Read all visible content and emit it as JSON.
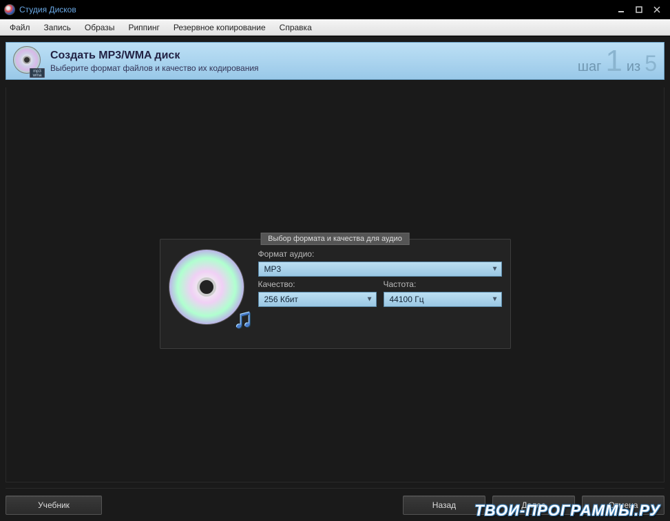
{
  "titlebar": {
    "title": "Студия Дисков"
  },
  "menu": {
    "items": [
      "Файл",
      "Запись",
      "Образы",
      "Риппинг",
      "Резервное копирование",
      "Справка"
    ]
  },
  "banner": {
    "icon_tag": "mp3\nwma",
    "title": "Создать MP3/WMA диск",
    "subtitle": "Выберите формат файлов и качество их кодирования",
    "step_prefix": "шаг",
    "step_current": "1",
    "step_sep": "из",
    "step_total": "5"
  },
  "group": {
    "legend": "Выбор формата и качества для аудио",
    "format_label": "Формат аудио:",
    "format_value": "MP3",
    "quality_label": "Качество:",
    "quality_value": "256 Кбит",
    "rate_label": "Частота:",
    "rate_value": "44100 Гц"
  },
  "buttons": {
    "tutorial": "Учебник",
    "back": "Назад",
    "next": "Далее",
    "cancel": "Отмена"
  },
  "watermark": "ТВОИ-ПРОГРАММЫ.РУ"
}
